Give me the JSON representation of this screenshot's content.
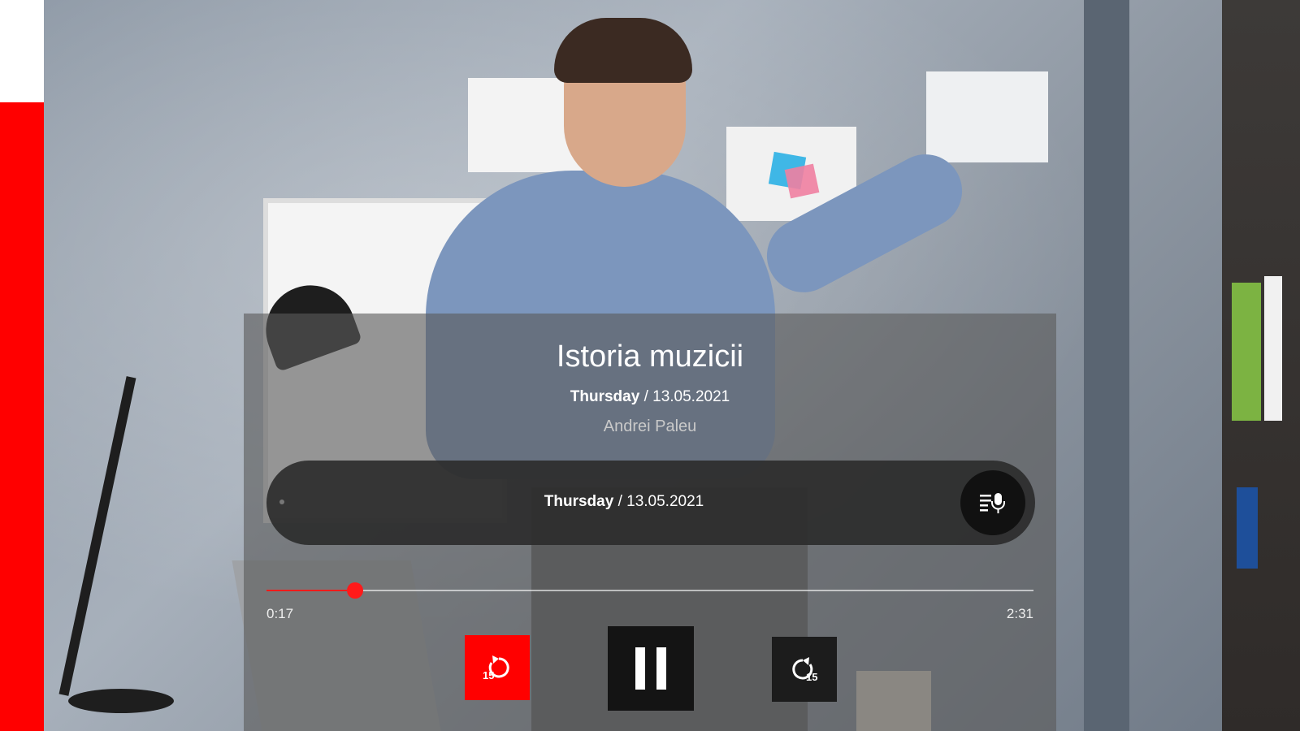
{
  "episode": {
    "title": "Istoria muzicii",
    "day": "Thursday",
    "date_sep": " / ",
    "date": "13.05.2021",
    "author": "Andrei Paleu"
  },
  "live_bar": {
    "day": "Thursday",
    "date_sep": " / ",
    "date": "13.05.2021",
    "button_icon": "live-mic-list-icon"
  },
  "player": {
    "current_time": "0:17",
    "total_time": "2:31",
    "progress_fraction": 0.115,
    "back_icon": "rewind-15-icon",
    "play_state_icon": "pause-icon",
    "forward_icon": "forward-15-icon"
  },
  "colors": {
    "accent": "#ff0000",
    "panel_overlay": "rgba(90,90,90,0.62)",
    "pill": "#2d2d2d"
  }
}
